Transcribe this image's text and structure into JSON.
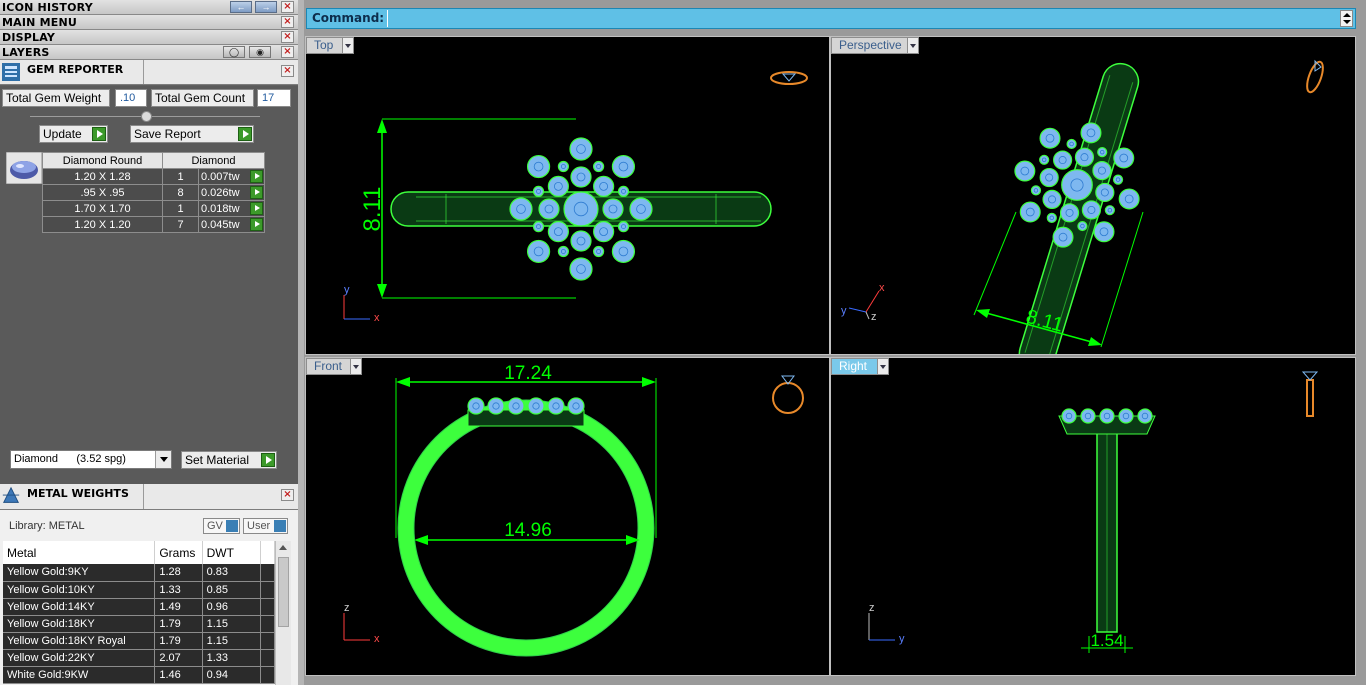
{
  "left_panel": {
    "bars": [
      {
        "label": "ICON HISTORY"
      },
      {
        "label": "MAIN MENU"
      },
      {
        "label": "DISPLAY"
      },
      {
        "label": "LAYERS"
      }
    ],
    "gem_reporter": {
      "title": "GEM REPORTER",
      "total_weight_label": "Total Gem Weight",
      "total_weight_value": ".10",
      "total_count_label": "Total Gem Count",
      "total_count_value": "17",
      "update_label": "Update",
      "save_report_label": "Save Report",
      "table": {
        "headers": [
          "Diamond Round",
          "Diamond"
        ],
        "rows": [
          {
            "size": "1.20 X 1.28",
            "count": "1",
            "weight": "0.007tw"
          },
          {
            "size": ".95 X .95",
            "count": "8",
            "weight": "0.026tw"
          },
          {
            "size": "1.70 X 1.70",
            "count": "1",
            "weight": "0.018tw"
          },
          {
            "size": "1.20 X 1.20",
            "count": "7",
            "weight": "0.045tw"
          }
        ]
      },
      "material_select": "Diamond      (3.52 spg)",
      "set_material_label": "Set Material"
    },
    "metal_weights": {
      "title": "METAL WEIGHTS",
      "library_label": "Library: METAL",
      "gv_label": "GV",
      "user_label": "User",
      "headers": [
        "Metal",
        "Grams",
        "DWT"
      ],
      "rows": [
        {
          "metal": "Yellow Gold:9KY",
          "grams": "1.28",
          "dwt": "0.83"
        },
        {
          "metal": "Yellow Gold:10KY",
          "grams": "1.33",
          "dwt": "0.85"
        },
        {
          "metal": "Yellow Gold:14KY",
          "grams": "1.49",
          "dwt": "0.96"
        },
        {
          "metal": "Yellow Gold:18KY",
          "grams": "1.79",
          "dwt": "1.15"
        },
        {
          "metal": "Yellow Gold:18KY Royal",
          "grams": "1.79",
          "dwt": "1.15"
        },
        {
          "metal": "Yellow Gold:22KY",
          "grams": "2.07",
          "dwt": "1.33"
        },
        {
          "metal": "White Gold:9KW",
          "grams": "1.46",
          "dwt": "0.94"
        }
      ]
    }
  },
  "command": {
    "label": "Command:"
  },
  "viewports": {
    "top": {
      "label": "Top",
      "dimension": "8.11",
      "axis_a": "y",
      "axis_b": "x"
    },
    "perspective": {
      "label": "Perspective",
      "dimension": "8.11",
      "axis_a": "x",
      "axis_b": "y",
      "axis_c": "z"
    },
    "front": {
      "label": "Front",
      "dimension_outer": "17.24",
      "dimension_inner": "14.96",
      "axis_a": "z",
      "axis_b": "x"
    },
    "right": {
      "label": "Right",
      "dimension": "1.54",
      "axis_a": "z",
      "axis_b": "y"
    }
  },
  "colors": {
    "wire": "#3dff3d",
    "dim": "#00ff00",
    "gem": "#7eb8f0",
    "accent": "#5fc0e6",
    "ortho": "#e8892a"
  }
}
